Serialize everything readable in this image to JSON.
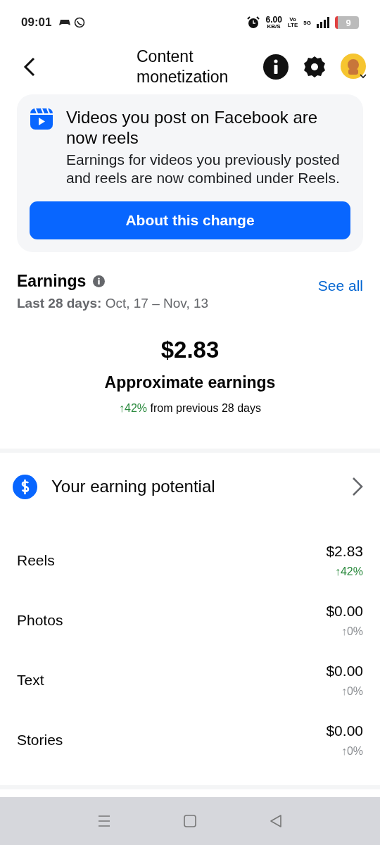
{
  "status_bar": {
    "time": "09:01",
    "speed": "6.00",
    "speed_unit": "KB/S",
    "volte_top": "Vo",
    "volte_bottom": "LTE",
    "network": "5G",
    "battery": "9"
  },
  "header": {
    "title": "Content monetization"
  },
  "notice": {
    "title": "Videos you post on Facebook are now reels",
    "body": "Earnings for videos you previously posted and reels are now combined under Reels.",
    "button": "About this change"
  },
  "earnings": {
    "title": "Earnings",
    "link": "See all",
    "range_label": "Last 28 days:",
    "range": "Oct, 17 – Nov, 13",
    "amount": "$2.83",
    "amount_label": "Approximate earnings",
    "change": "↑42%",
    "change_positive": true,
    "change_text": "from previous 28 days"
  },
  "potential": {
    "title": "Your earning potential"
  },
  "breakdown": [
    {
      "label": "Reels",
      "amount": "$2.83",
      "change": "↑42%",
      "positive": true
    },
    {
      "label": "Photos",
      "amount": "$0.00",
      "change": "↑0%",
      "positive": false
    },
    {
      "label": "Text",
      "amount": "$0.00",
      "change": "↑0%",
      "positive": false
    },
    {
      "label": "Stories",
      "amount": "$0.00",
      "change": "↑0%",
      "positive": false
    }
  ]
}
